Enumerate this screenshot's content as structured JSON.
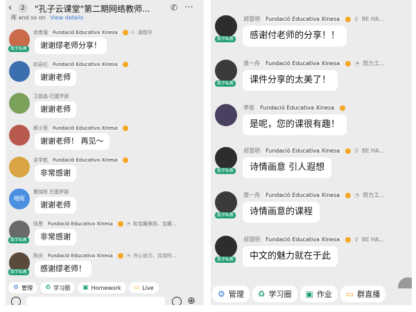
{
  "left_panel": {
    "header": {
      "unread_count": "2",
      "group_title": "\"孔子云课堂\"第二期网络教师...",
      "subline_text": "晖 and so on",
      "subline_link": "View details",
      "icons": [
        "back-arrow-icon",
        "video-call-icon",
        "more-menu-icon"
      ]
    },
    "messages": [
      {
        "name": "徐墨强",
        "org": "Fundació Educativa Xinesa",
        "extra": "源我中",
        "text": "谢谢缪老师分享！",
        "vip": "数学私教"
      },
      {
        "name": "赵岩红",
        "org": "Fundació Educativa Xinesa",
        "extra": "",
        "text": "谢谢老师",
        "vip": ""
      },
      {
        "name": "卫晶晶-巴塞罗那",
        "org": "",
        "extra": "",
        "text": "谢谢老师",
        "vip": ""
      },
      {
        "name": "郝小莹",
        "org": "Fundació Educativa Xinesa",
        "extra": "",
        "text": "谢谢老师！ 再见～",
        "vip": ""
      },
      {
        "name": "金学航",
        "org": "Fundació Educativa Xinesa",
        "extra": "",
        "text": "非常感谢",
        "vip": ""
      },
      {
        "name": "曹晓晖 巴塞罗那",
        "org": "",
        "extra": "",
        "text": "谢谢老师",
        "vip": "",
        "avatar_text": "晓晖"
      },
      {
        "name": "陆恩",
        "org": "Fundació Educativa Xinesa",
        "extra": "和宝藏美扬、宝藏...",
        "text": "非常感谢",
        "vip": "数学私教"
      },
      {
        "name": "陈庆",
        "org": "Fundació Educativa Xinesa",
        "extra": "齐心协力、共克时...",
        "text": "感谢缪老师！",
        "vip": "数学私教"
      }
    ],
    "toolbar": [
      {
        "label": "管理",
        "icon": "settings-icon"
      },
      {
        "label": "学习圈",
        "icon": "circle-icon"
      },
      {
        "label": "Homework",
        "icon": "homework-icon"
      },
      {
        "label": "Live",
        "icon": "live-icon"
      }
    ]
  },
  "right_panel": {
    "messages": [
      {
        "name": "郑慧明",
        "org": "Fundació Educativa Xinesa",
        "extra": "BE HA...",
        "text": "感谢付老师的分享！！",
        "vip": "数学私教"
      },
      {
        "name": "龚一舟",
        "org": "Fundació Educativa Xinesa",
        "extra": "努力工...",
        "text": "课件分享的太美了！",
        "vip": "数学私教"
      },
      {
        "name": "李俊",
        "org": "Fundació Educativa Xinesa",
        "extra": "",
        "text": "是呢，您的课很有趣！",
        "vip": ""
      },
      {
        "name": "郑慧明",
        "org": "Fundació Educativa Xinesa",
        "extra": "BE HA...",
        "text": "诗情画意 引人遐想",
        "vip": "数学私教"
      },
      {
        "name": "龚一舟",
        "org": "Fundació Educativa Xinesa",
        "extra": "努力工...",
        "text": "诗情画意的课程",
        "vip": "数学私教"
      },
      {
        "name": "郑慧明",
        "org": "Fundació Educativa Xinesa",
        "extra": "BE HA...",
        "text": "中文的魅力就在于此",
        "vip": "数学私教"
      }
    ],
    "toolbar": [
      {
        "label": "管理",
        "icon": "settings-icon"
      },
      {
        "label": "学习圈",
        "icon": "circle-icon"
      },
      {
        "label": "作业",
        "icon": "homework-icon"
      },
      {
        "label": "群直播",
        "icon": "live-icon"
      }
    ]
  },
  "colors": {
    "background": "#ececec",
    "bubble": "#ffffff",
    "accent_green": "#1e9c74",
    "link_blue": "#3a7bd5",
    "verified_orange": "#f5a623"
  }
}
